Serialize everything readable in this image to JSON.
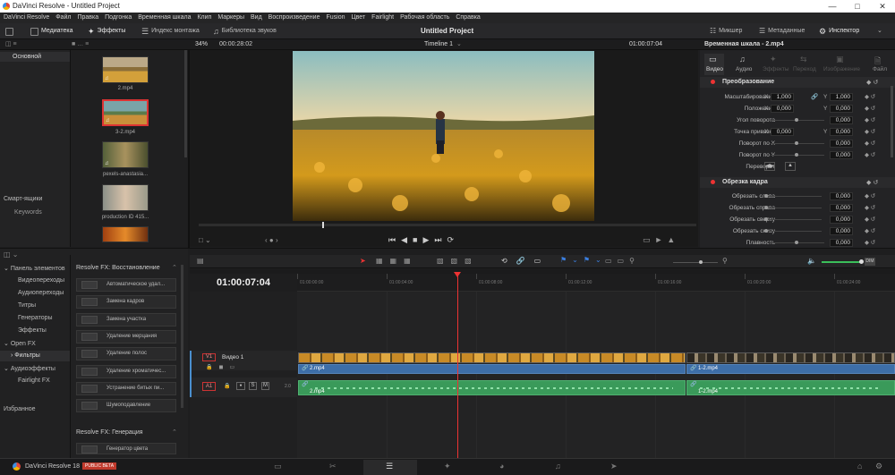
{
  "window": {
    "title": "DaVinci Resolve - Untitled Project"
  },
  "menu": [
    "DaVinci Resolve",
    "Файл",
    "Правка",
    "Подгонка",
    "Временная шкала",
    "Клип",
    "Маркеры",
    "Вид",
    "Воспроизведение",
    "Fusion",
    "Цвет",
    "Fairlight",
    "Рабочая область",
    "Справка"
  ],
  "toolbar": {
    "media": "Медиатека",
    "effects": "Эффекты",
    "edit_index": "Индекс монтажа",
    "sound_library": "Библиотека звуков",
    "project_title": "Untitled Project",
    "mixer": "Микшер",
    "metadata": "Метаданные",
    "inspector": "Инспектор"
  },
  "subbar": {
    "zoom": "34%",
    "timecode": "00:00:28:02",
    "timeline_name": "Timeline 1",
    "current_time": "01:00:07:04",
    "inspector_title": "Временная шкала - 2.mp4"
  },
  "media_pool": {
    "bin_master": "Основной",
    "smart_bins": "Смарт-ящики",
    "keywords": "Keywords",
    "clips": [
      {
        "label": "2.mp4"
      },
      {
        "label": "3-2.mp4"
      },
      {
        "label": "pexels-anastasia..."
      },
      {
        "label": "production ID 415..."
      },
      {
        "label": ""
      }
    ]
  },
  "inspector": {
    "tabs": [
      "Видео",
      "Аудио",
      "Эффекты",
      "Переход",
      "Изображение",
      "Файл"
    ],
    "transform_title": "Преобразование",
    "rows": [
      {
        "label": "Масштабирование",
        "axis1": "X",
        "v1": "1,000",
        "axis2": "Y",
        "v2": "1,000"
      },
      {
        "label": "Положение",
        "axis1": "X",
        "v1": "0,000",
        "axis2": "Y",
        "v2": "0,000"
      },
      {
        "label": "Угол поворота",
        "v2": "0,000"
      },
      {
        "label": "Точка привязки",
        "axis1": "X",
        "v1": "0,000",
        "axis2": "Y",
        "v2": "0,000"
      },
      {
        "label": "Поворот по X",
        "v2": "0,000"
      },
      {
        "label": "Поворот по Y",
        "v2": "0,000"
      },
      {
        "label": "Переворот"
      }
    ],
    "crop_title": "Обрезка кадра",
    "crop_rows": [
      {
        "label": "Обрезать слева",
        "v": "0,000"
      },
      {
        "label": "Обрезать справа",
        "v": "0,000"
      },
      {
        "label": "Обрезать сверху",
        "v": "0,000"
      },
      {
        "label": "Обрезать снизу",
        "v": "0,000"
      },
      {
        "label": "Плавность",
        "v": "0,000"
      }
    ]
  },
  "effects": {
    "tree": [
      "Панель элементов",
      "Видеопереходы",
      "Аудиопереходы",
      "Титры",
      "Генераторы",
      "Эффекты",
      "Open FX",
      "Фильтры",
      "Аудиоэффекты",
      "Fairlight FX",
      "Избранное"
    ],
    "section1": "Resolve FX: Восстановление",
    "items": [
      "Автоматическое удал...",
      "Замена кадров",
      "Замена участка",
      "Удаление мерцания",
      "Удаление полос",
      "Удаление хроматичес...",
      "Устранение битых пи...",
      "Шумоподавление"
    ],
    "section2": "Resolve FX: Генерация",
    "item_gen": "Генератор цвета"
  },
  "timeline": {
    "timecode": "01:00:07:04",
    "ruler": [
      "01:00:00:00",
      "01:00:04:00",
      "01:00:08:00",
      "01:00:12:00",
      "01:00:16:00",
      "01:00:20:00",
      "01:00:24:00"
    ],
    "video_track_id": "V1",
    "video_track_name": "Видео 1",
    "audio_track_id": "A1",
    "audio_level": "2.0",
    "clips": {
      "a1": "2.mp4",
      "a2": "1-2.mp4",
      "g1": "2.mp4",
      "g2": "1-2.mp4"
    },
    "track_buttons": [
      "S",
      "M"
    ],
    "level_label": "DIM"
  },
  "status": {
    "app": "DaVinci Resolve 18",
    "beta": "PUBLIC BETA"
  }
}
